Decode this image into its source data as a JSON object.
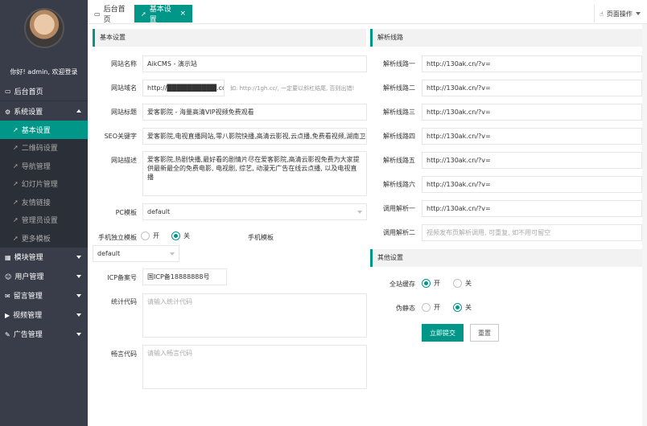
{
  "sidebar": {
    "welcome": "你好! admin, 欢迎登录",
    "home": "后台首页",
    "groups": [
      {
        "label": "系统设置",
        "open": true,
        "items": [
          "基本设置",
          "二维码设置",
          "导航管理",
          "幻灯片管理",
          "友情链接",
          "管理员设置",
          "更多模板"
        ]
      },
      {
        "label": "模块管理"
      },
      {
        "label": "用户管理"
      },
      {
        "label": "留言管理"
      },
      {
        "label": "视频管理"
      },
      {
        "label": "广告管理"
      }
    ]
  },
  "tabs": {
    "home": "后台首页",
    "current": "基本设置",
    "close": "×",
    "page_ops": "页面操作"
  },
  "basic": {
    "title": "基本设置",
    "site_name_label": "网站名称",
    "site_name": "AikCMS - 演示站",
    "domain_label": "网站域名",
    "domain": "http://██████████.com/",
    "domain_hint": "如: http://1gh.cc/, 一定要以斜杠结尾, 否则出错!",
    "site_title_label": "网站标题",
    "site_title": "爱客影院 - 海量高清VIP视频免费观看",
    "seo_label": "SEO关键字",
    "seo": "爱客影院,电视直播网站,零八影院快播,高清云影视,云点播,免费看视频,湖南卫视直播",
    "desc_label": "网站描述",
    "desc": "爱客影院,热剧快播,最好看的剧情片尽在爱客影院,高清云影视免费为大家提供最新最全的免费电影, 电视剧, 综艺, 动漫无广告在线云点播, 以及电视直播",
    "pc_tpl_label": "PC模板",
    "pc_tpl": "default",
    "mobile_indep_label": "手机独立模板",
    "on": "开",
    "off": "关",
    "mobile_tpl_label": "手机模板",
    "mobile_tpl": "default",
    "icp_label": "ICP备案号",
    "icp": "国ICP备18888888号",
    "stats_label": "统计代码",
    "stats_ph": "请输入统计代码",
    "ad_label": "畅言代码",
    "ad_ph": "请输入畅言代码"
  },
  "parse": {
    "title": "解析线路",
    "lines": [
      {
        "label": "解析线路一",
        "value": "http://130ak.cn/?v="
      },
      {
        "label": "解析线路二",
        "value": "http://130ak.cn/?v="
      },
      {
        "label": "解析线路三",
        "value": "http://130ak.cn/?v="
      },
      {
        "label": "解析线路四",
        "value": "http://130ak.cn/?v="
      },
      {
        "label": "解析线路五",
        "value": "http://130ak.cn/?v="
      },
      {
        "label": "解析线路六",
        "value": "http://130ak.cn/?v="
      },
      {
        "label": "调用解析一",
        "value": "http://130ak.cn/?v="
      }
    ],
    "call2_label": "调用解析二",
    "call2_ph": "视频发布页解析调用, 可重复, 如不用可留空"
  },
  "other": {
    "title": "其他设置",
    "cache_label": "全站缓存",
    "static_label": "伪静态",
    "on": "开",
    "off": "关",
    "submit": "立即提交",
    "reset": "重置"
  },
  "colors": {
    "accent": "#009688",
    "sidebar_bg": "#393d49"
  }
}
